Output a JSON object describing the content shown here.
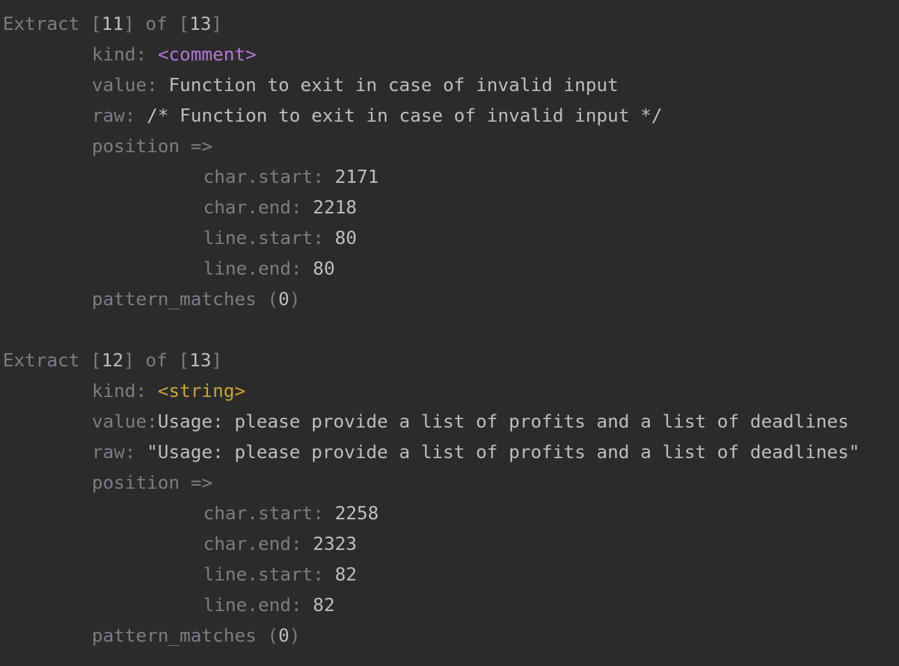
{
  "colors": {
    "background": "#2b2b2b",
    "label_dim": "#7b7e84",
    "value_text": "#bcbec4",
    "kind_comment": "#b178d8",
    "kind_string": "#c9a635"
  },
  "labels": {
    "extract_word": "Extract ",
    "of_word": " of ",
    "bracket_open": "[",
    "bracket_close": "]",
    "kind": "kind: ",
    "value": "value: ",
    "value_nospace": "value:",
    "raw": "raw: ",
    "position": "position =>",
    "char_start": "char.start: ",
    "char_end": "char.end: ",
    "line_start": "line.start: ",
    "line_end": "line.end: ",
    "pattern_matches": "pattern_matches (",
    "paren_close": ")"
  },
  "extracts": [
    {
      "index": "11",
      "total": "13",
      "kind": "<comment>",
      "value": "Function to exit in case of invalid input",
      "raw": "/* Function to exit in case of invalid input */",
      "char_start": "2171",
      "char_end": "2218",
      "line_start": "80",
      "line_end": "80",
      "pattern_matches": "0"
    },
    {
      "index": "12",
      "total": "13",
      "kind": "<string>",
      "value": "Usage: please provide a list of profits and a list of deadlines",
      "raw": "\"Usage: please provide a list of profits and a list of deadlines\"",
      "char_start": "2258",
      "char_end": "2323",
      "line_start": "82",
      "line_end": "82",
      "pattern_matches": "0"
    }
  ]
}
